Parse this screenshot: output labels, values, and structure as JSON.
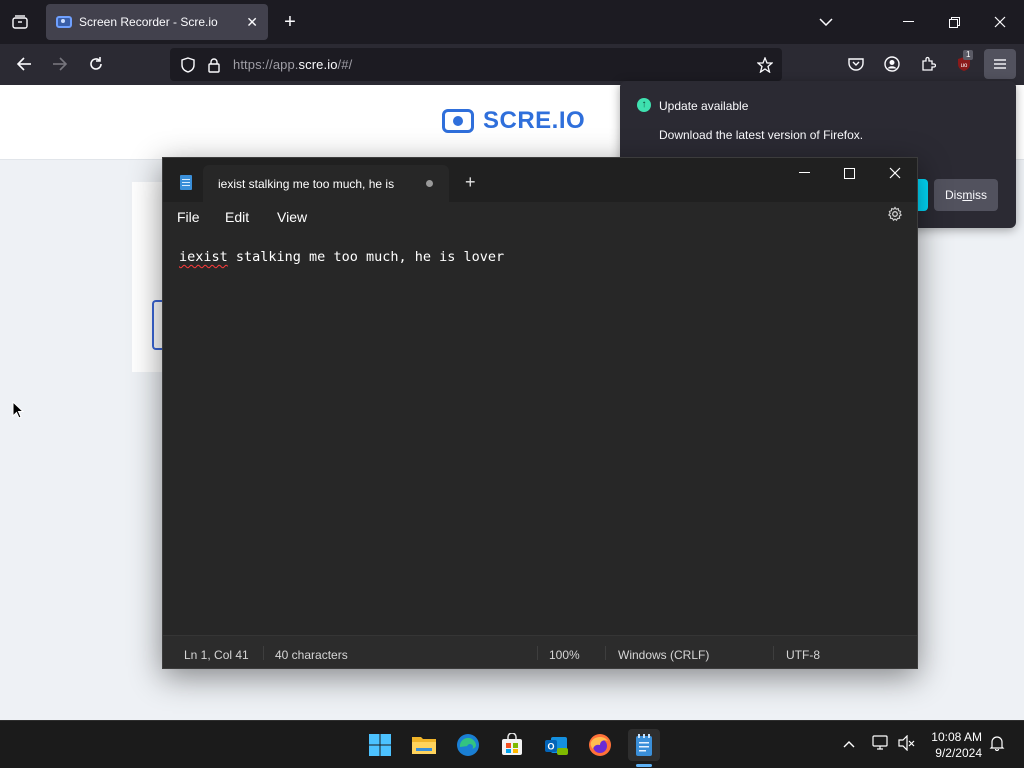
{
  "browser": {
    "tab_title": "Screen Recorder - Scre.io",
    "tab_close": "✕",
    "new_tab": "+",
    "url_prefix": "https://app.",
    "url_host": "scre.io",
    "url_suffix": "/#/",
    "ublock_badge": "1"
  },
  "page": {
    "logo_text": "SCRE.IO"
  },
  "update_popup": {
    "title": "Update available",
    "description": "Download the latest version of Firefox.",
    "dismiss_pre": "Dis",
    "dismiss_underlined": "m",
    "dismiss_post": "iss"
  },
  "notepad": {
    "tab_title": "iexist stalking me too much, he is",
    "new_tab": "+",
    "minimize": "—",
    "maximize": "☐",
    "close": "✕",
    "menu": {
      "file": "File",
      "edit": "Edit",
      "view": "View"
    },
    "content_misspelled": "iexist",
    "content_rest": " stalking me too much, he is lover",
    "status": {
      "position": "Ln 1, Col 41",
      "characters": "40 characters",
      "zoom": "100%",
      "line_endings": "Windows (CRLF)",
      "encoding": "UTF-8"
    }
  },
  "taskbar": {
    "time": "10:08 AM",
    "date": "9/2/2024"
  },
  "colors": {
    "accent_blue": "#2f6fdb",
    "firefox_update_green": "#3fe1b0",
    "firefox_update_button": "#00ddff",
    "notepad_bg": "#272727"
  }
}
